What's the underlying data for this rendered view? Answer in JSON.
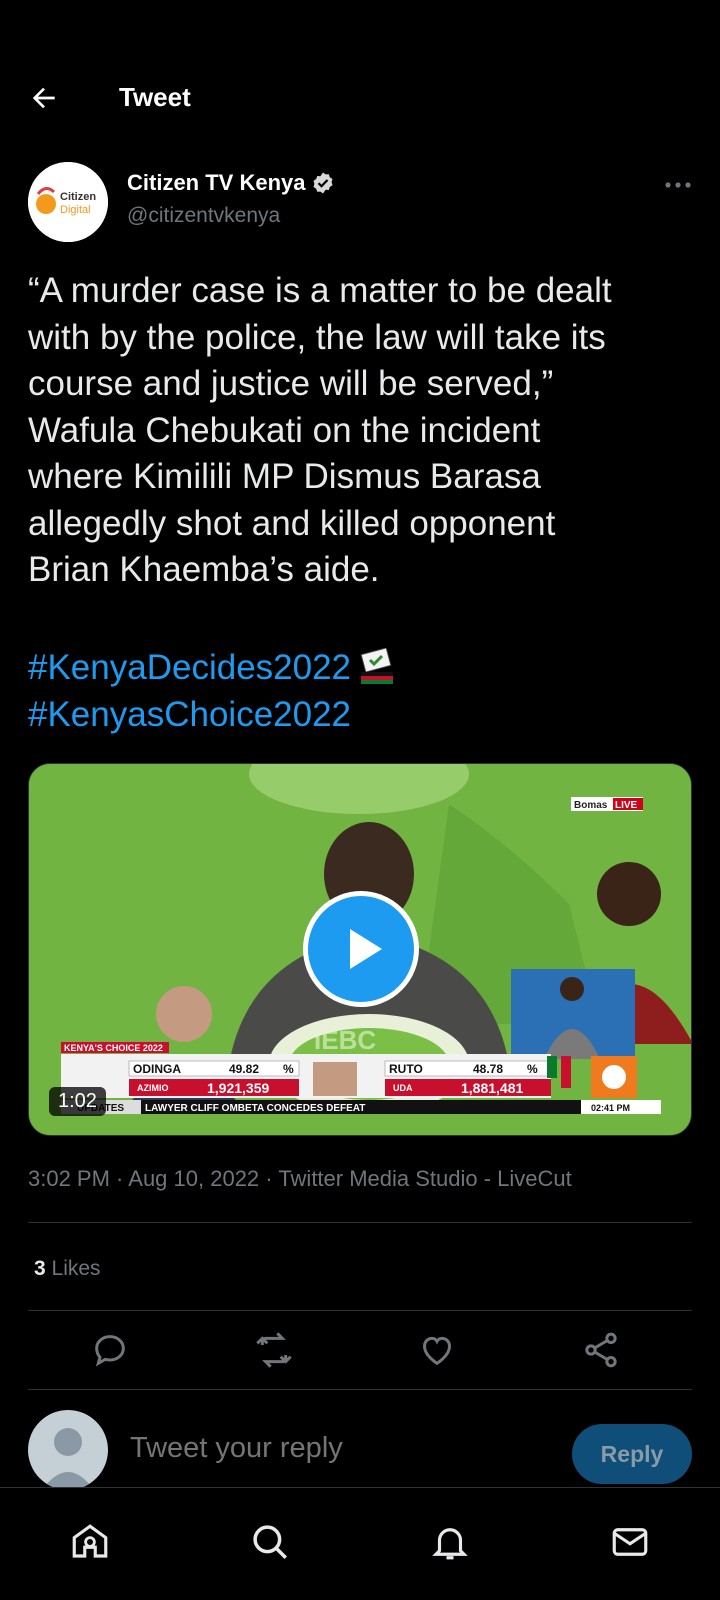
{
  "header": {
    "title": "Tweet",
    "back_icon": "arrow-left-icon"
  },
  "author": {
    "name": "Citizen TV Kenya",
    "handle": "@citizentvkenya",
    "verified_icon": "verified-badge-icon",
    "avatar_text": [
      "Citizen",
      "Digital"
    ]
  },
  "tweet": {
    "lines": [
      "“A murder case is a matter to be dealt",
      "with by the police, the law will take its",
      "course and justice will be served,”",
      "Wafula Chebukati on the incident",
      "where Kimilili MP Dismus Barasa",
      "allegedly shot and killed opponent",
      "Brian Khaemba’s aide."
    ],
    "hashtags": [
      "#KenyaDecides2022",
      "#KenyasChoice2022"
    ]
  },
  "media": {
    "duration": "1:02",
    "live_tag": "Bomas",
    "live_badge": "LIVE",
    "ticker": {
      "show_title": "KENYA'S CHOICE 2022",
      "candidate1_name": "ODINGA",
      "candidate1_pct": "49.82",
      "candidate1_party": "AZIMIO",
      "candidate1_votes": "1,921,359",
      "candidate2_name": "RUTO",
      "candidate2_pct": "48.78",
      "candidate2_party": "UDA",
      "candidate2_votes": "1,881,481",
      "pct_sign": "%",
      "updates_label": "UPDATES",
      "headline": "LAWYER CLIFF OMBETA CONCEDES DEFEAT",
      "clock": "02:41 PM"
    },
    "podium_text": "IEBC"
  },
  "meta": {
    "text": "3:02 PM · Aug 10, 2022 · Twitter Media Studio - LiveCut"
  },
  "likes": {
    "count": "3",
    "label": "Likes"
  },
  "reply": {
    "placeholder": "Tweet your reply",
    "button": "Reply"
  },
  "colors": {
    "accent": "#1d9bf0",
    "muted": "#71767b",
    "divider": "#2f3336"
  }
}
